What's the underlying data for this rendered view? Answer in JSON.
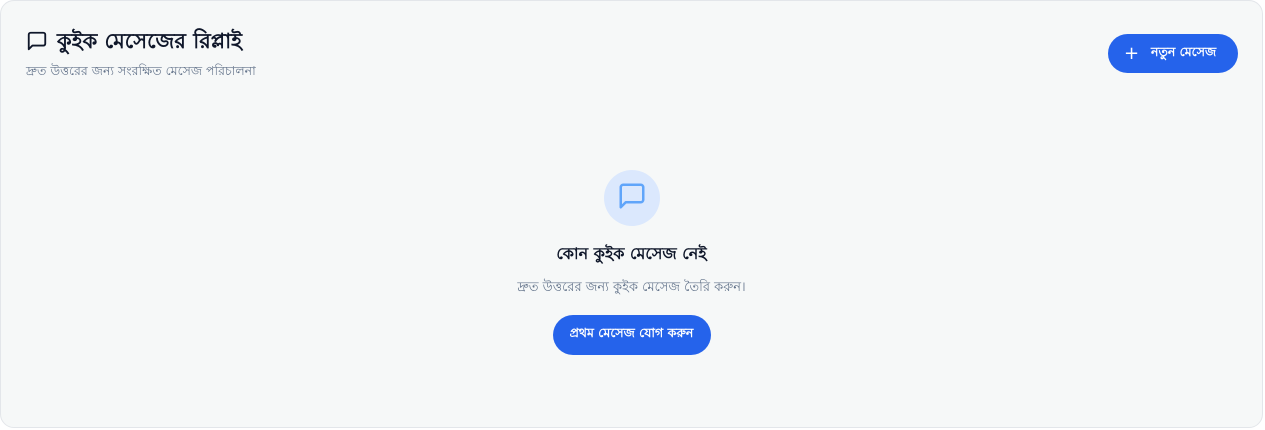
{
  "header": {
    "title": "কুইক মেসেজের রিপ্লাই",
    "subtitle": "দ্রুত উত্তরের জন্য সংরক্ষিত মেসেজ পরিচালনা",
    "title_icon": "message-square-icon"
  },
  "actions": {
    "new_message_label": "নতুন মেসেজ",
    "new_message_icon": "plus-icon",
    "plus_glyph": "+"
  },
  "empty_state": {
    "icon": "message-square-icon",
    "title": "কোন কুইক মেসেজ নেই",
    "description": "দ্রুত উত্তরের জন্য কুইক মেসেজ তৈরি করুন।",
    "cta_label": "প্রথম মেসেজ যোগ করুন"
  },
  "colors": {
    "primary": "#2563eb",
    "panel_bg": "#f6f8f8",
    "icon_circle_bg": "#dbe8fd",
    "icon_accent": "#60a5fa",
    "text_dark": "#0f172a",
    "text_muted": "#64748b"
  }
}
